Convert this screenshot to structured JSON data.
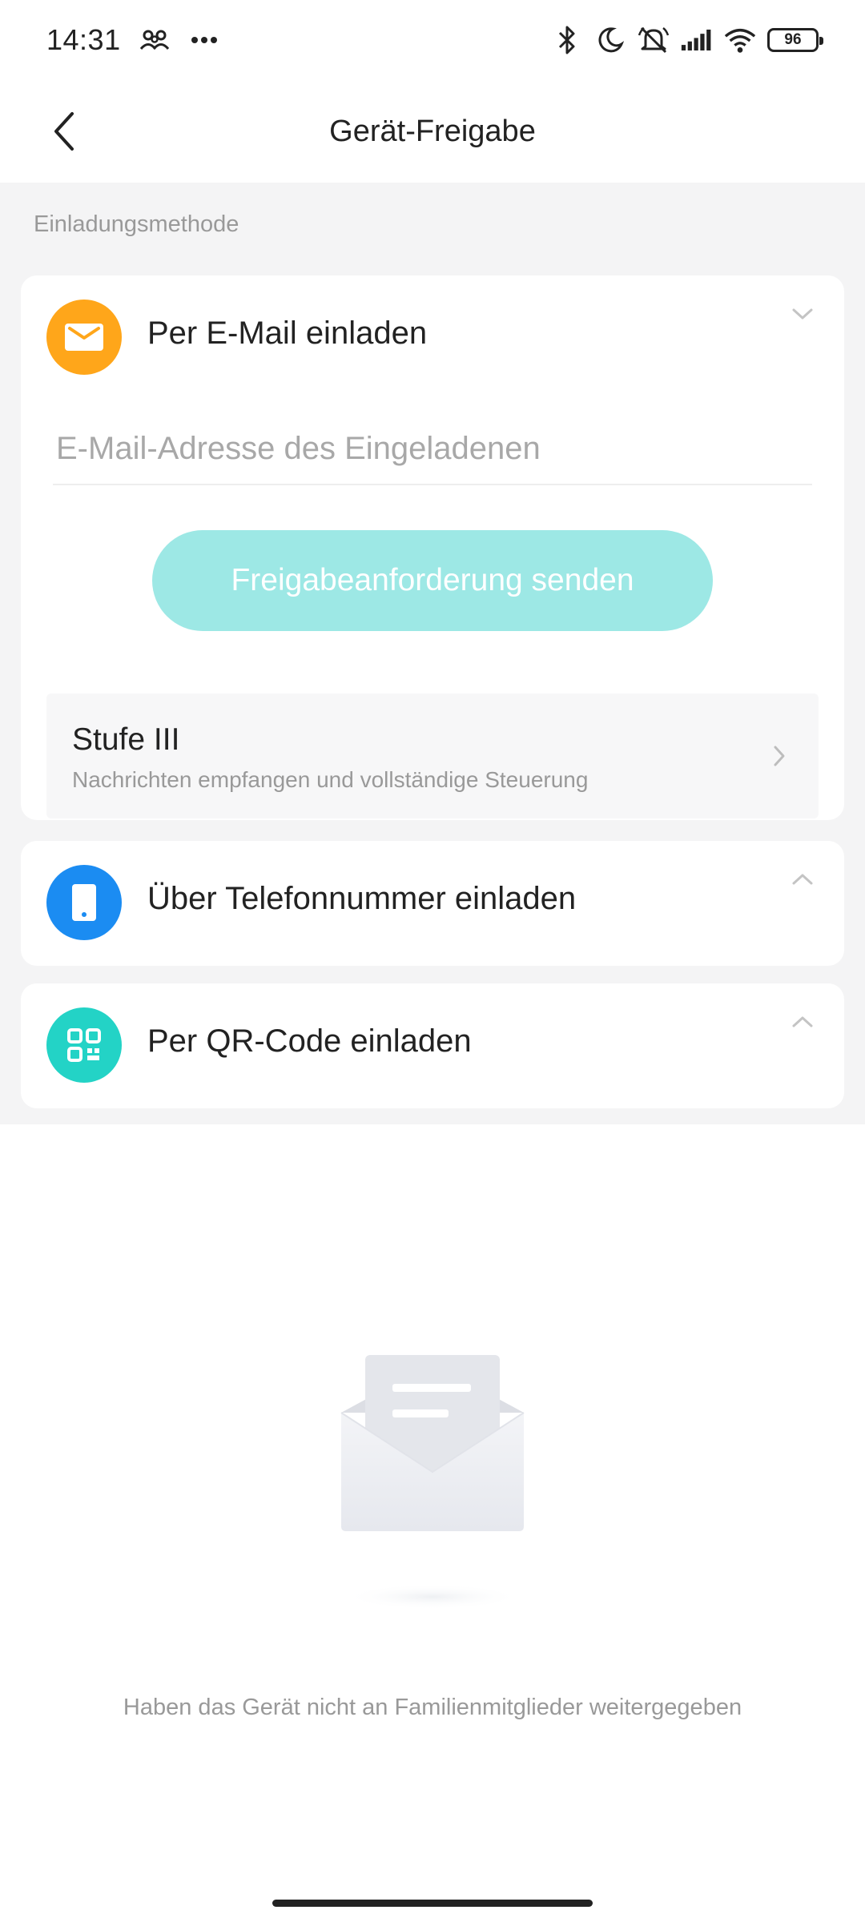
{
  "status_bar": {
    "time": "14:31",
    "battery": "96",
    "icons": [
      "family-icon",
      "more-dots-icon",
      "bluetooth-icon",
      "moon-icon",
      "mute-icon",
      "signal-icon",
      "wifi-icon",
      "battery-icon"
    ]
  },
  "header": {
    "title": "Gerät-Freigabe",
    "back_icon": "chevron-left-icon"
  },
  "section_label": "Einladungsmethode",
  "invite_methods": {
    "email": {
      "title": "Per E-Mail einladen",
      "icon": "mail-icon",
      "icon_color": "#ffa61a",
      "expanded": true,
      "input_placeholder": "E-Mail-Adresse des Eingeladenen",
      "input_value": "",
      "send_button": "Freigabeanforderung senden",
      "send_button_color": "#9de8e5",
      "level": {
        "title": "Stufe III",
        "subtitle": "Nachrichten empfangen und vollständige Steuerung"
      }
    },
    "phone": {
      "title": "Über Telefonnummer einladen",
      "icon": "phone-icon",
      "icon_color": "#1b8cf2",
      "expanded": false
    },
    "qr": {
      "title": "Per QR-Code einladen",
      "icon": "qr-code-icon",
      "icon_color": "#23d3c6",
      "expanded": false
    }
  },
  "empty_state": {
    "illustration": "envelope-illustration",
    "text": "Haben das Gerät nicht an Familienmitglieder weitergegeben"
  }
}
